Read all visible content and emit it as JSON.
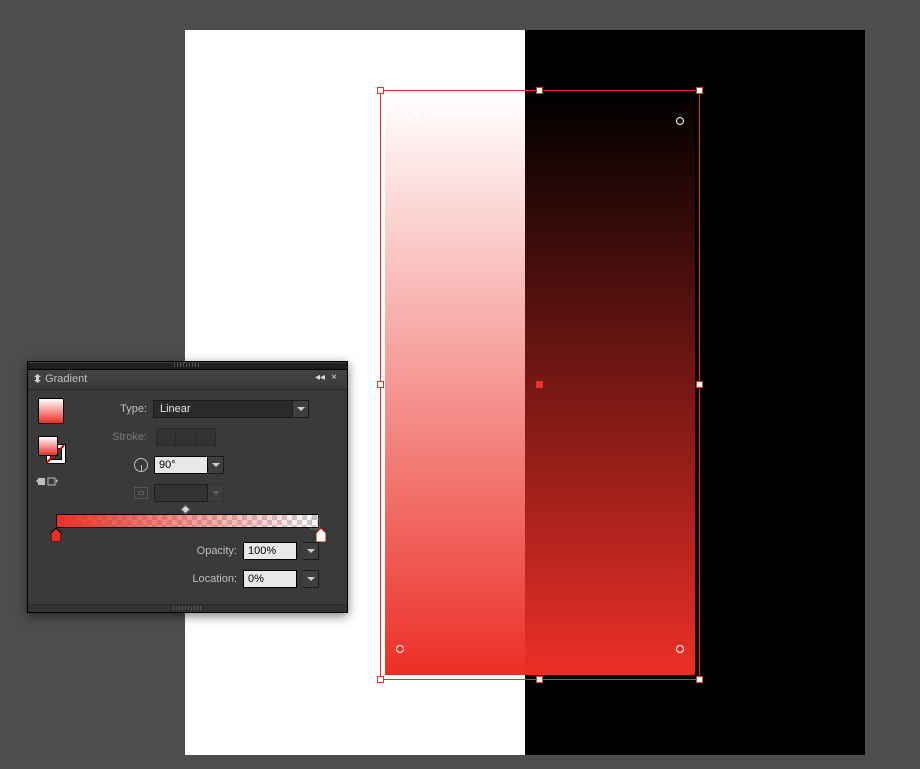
{
  "panel": {
    "title": "Gradient",
    "type_label": "Type:",
    "type_value": "Linear",
    "stroke_label": "Stroke:",
    "angle_value": "90°",
    "aspect_value": "",
    "opacity_label": "Opacity:",
    "opacity_value": "100%",
    "location_label": "Location:",
    "location_value": "0%"
  },
  "gradient": {
    "stops": [
      {
        "color": "#ec2f27",
        "opacity": 100,
        "location": 0
      },
      {
        "color": "#ffffff",
        "opacity": 0,
        "location": 100
      }
    ],
    "angle": 90,
    "type": "Linear"
  },
  "icons": {
    "collapse": "◂◂",
    "close": "×"
  }
}
